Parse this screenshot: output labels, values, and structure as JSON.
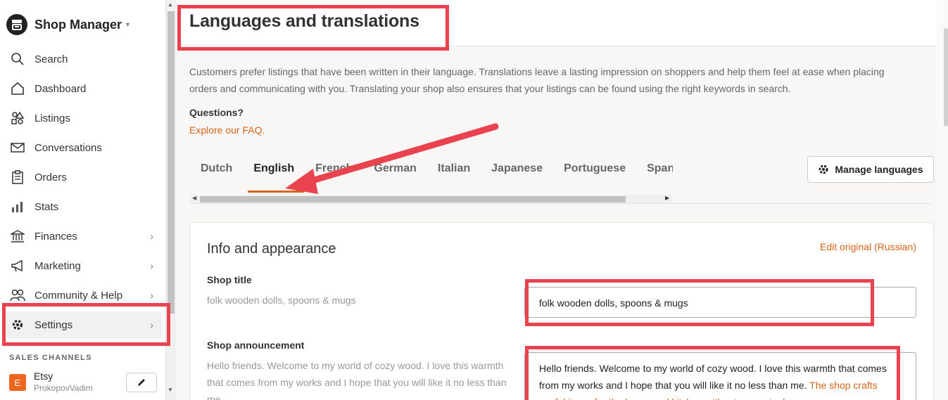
{
  "brand": {
    "title": "Shop Manager",
    "caret": "▾"
  },
  "nav": [
    {
      "label": "Search",
      "icon": "search-icon"
    },
    {
      "label": "Dashboard",
      "icon": "home-icon"
    },
    {
      "label": "Listings",
      "icon": "shapes-icon"
    },
    {
      "label": "Conversations",
      "icon": "mail-icon"
    },
    {
      "label": "Orders",
      "icon": "clipboard-icon"
    },
    {
      "label": "Stats",
      "icon": "bar-chart-icon"
    },
    {
      "label": "Finances",
      "icon": "bank-icon"
    },
    {
      "label": "Marketing",
      "icon": "megaphone-icon"
    },
    {
      "label": "Community & Help",
      "icon": "people-icon"
    },
    {
      "label": "Settings",
      "icon": "gear-icon"
    }
  ],
  "sales_channels": {
    "heading": "SALES CHANNELS",
    "channel_name": "Etsy",
    "channel_badge": "E",
    "channel_user": "ProkopovVadim"
  },
  "page": {
    "title": "Languages and translations",
    "intro": "Customers prefer listings that have been written in their language. Translations leave a lasting impression on shoppers and help them feel at ease when placing orders and communicating with you. Translating your shop also ensures that your listings can be found using the right keywords in search.",
    "questions": "Questions?",
    "faq_link": "Explore our FAQ."
  },
  "tabs": [
    {
      "label": "Dutch",
      "active": false
    },
    {
      "label": "English",
      "active": true
    },
    {
      "label": "French",
      "active": false
    },
    {
      "label": "German",
      "active": false
    },
    {
      "label": "Italian",
      "active": false
    },
    {
      "label": "Japanese",
      "active": false
    },
    {
      "label": "Portuguese",
      "active": false
    },
    {
      "label": "Spanish",
      "active": false
    }
  ],
  "manage_languages": "Manage languages",
  "card": {
    "title": "Info and appearance",
    "edit_original": "Edit original (Russian)",
    "shop_title_label": "Shop title",
    "shop_title_original": "folk wooden dolls, spoons & mugs",
    "shop_title_value": "folk wooden dolls, spoons & mugs",
    "announcement_label": "Shop announcement",
    "announcement_original": "Hello friends. Welcome to my world of cozy wood. I love this warmth that comes from my works and I hope that you will like it no less than me.",
    "announcement_value": "Hello friends. Welcome to my world of cozy wood. I love this warmth that comes from my works and I hope that you will like it no less than me.",
    "announcement_overflow": "The shop crafts useful items for the home and kitchen without power tools"
  },
  "colors": {
    "accent": "#d5641c",
    "annotation": "#e8434f"
  }
}
